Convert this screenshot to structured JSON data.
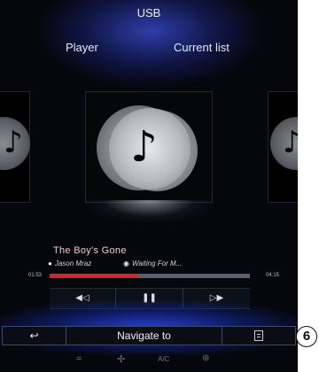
{
  "header": {
    "title": "USB"
  },
  "tabs": [
    {
      "label": "Player"
    },
    {
      "label": "Current list"
    }
  ],
  "track": {
    "title": "The Boy's Gone",
    "artist": "Jason Mraz",
    "album": "Waiting For M...",
    "elapsed": "01:53",
    "total": "04:15",
    "progress_fraction": 0.44
  },
  "controls": {
    "prev_icon": "previous-icon",
    "prev_glyph": "◀◁",
    "pause_icon": "pause-icon",
    "pause_glyph": "❚❚",
    "next_icon": "next-icon",
    "next_glyph": "▷▶"
  },
  "bottom_bar": {
    "back_glyph": "↩",
    "navigate_label": "Navigate to",
    "list_icon": "document-list-icon"
  },
  "climate": {
    "seat_glyph": "≈",
    "fan_glyph": "✢",
    "ac_label": "A/C",
    "defrost_glyph": "⊛"
  },
  "callout": {
    "number": "6"
  },
  "colors": {
    "accent_glow": "#2846e6",
    "progress": "#d4252b",
    "track_title": "#f0c9d2"
  }
}
